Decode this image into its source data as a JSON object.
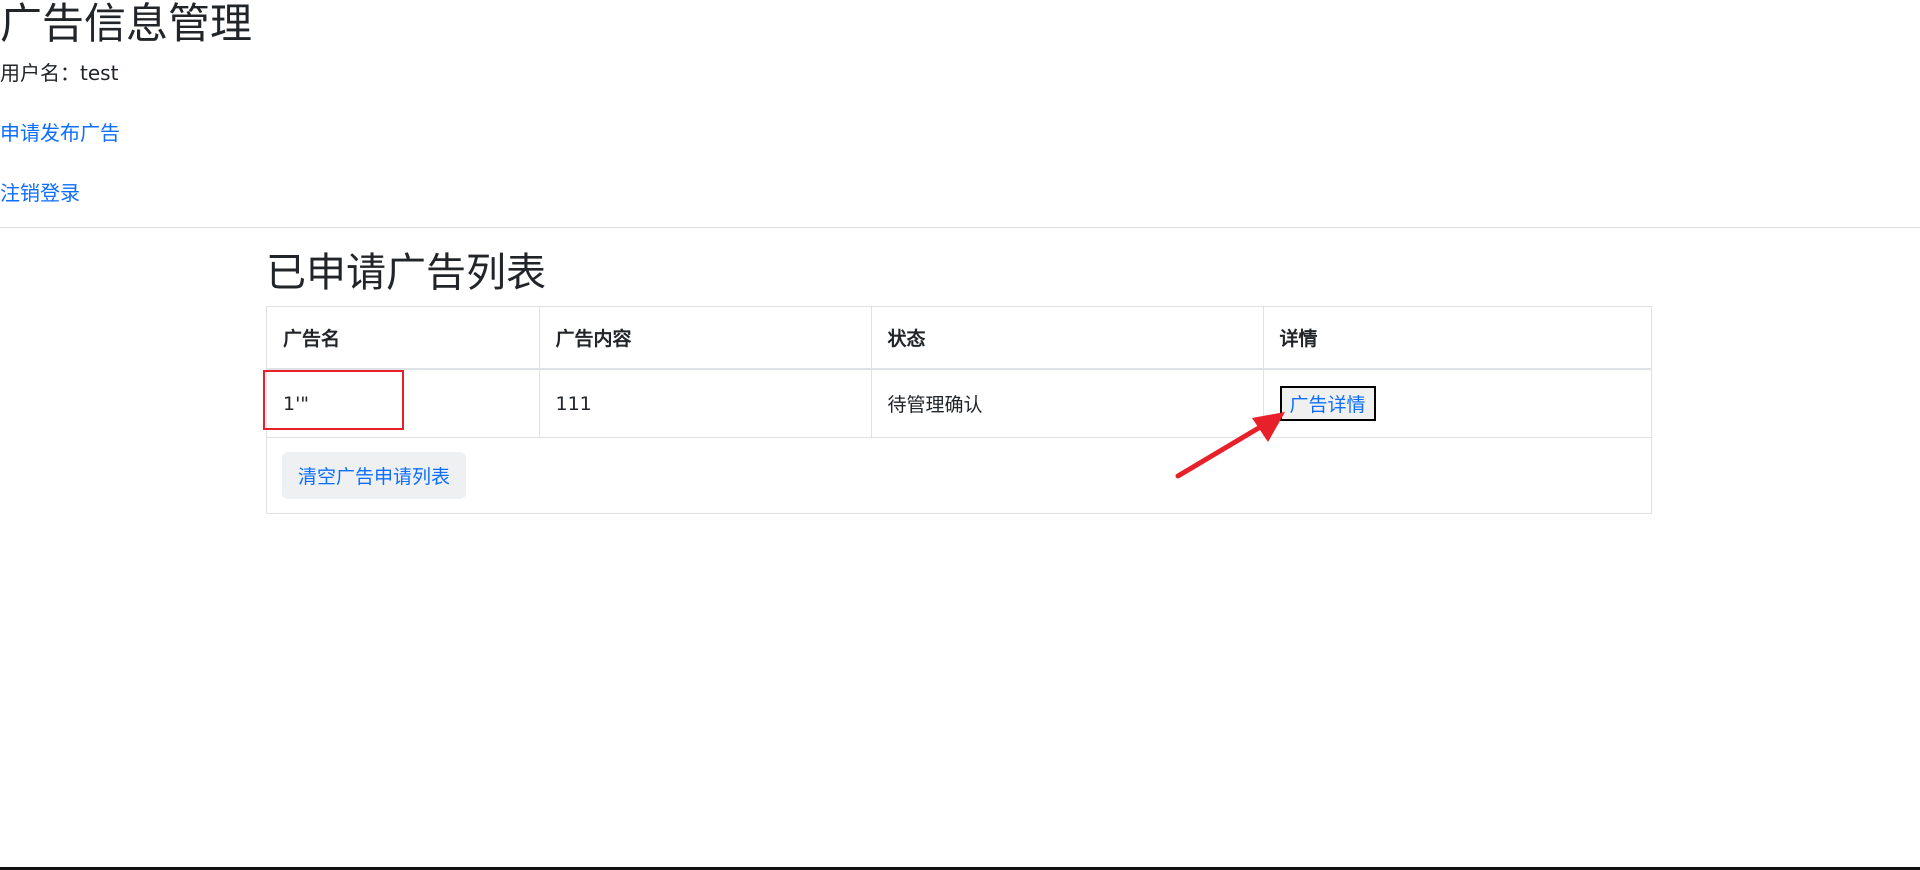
{
  "header": {
    "title": "广告信息管理",
    "username_line": "用户名：test"
  },
  "nav": {
    "apply_link": "申请发布广告",
    "logout_link": "注销登录"
  },
  "main": {
    "section_title": "已申请广告列表",
    "table": {
      "columns": [
        "广告名",
        "广告内容",
        "状态",
        "详情"
      ],
      "rows": [
        {
          "name": "1'\"",
          "content": "111",
          "status": "待管理确认",
          "detail_button": "广告详情"
        }
      ]
    },
    "clear_button": "清空广告申请列表"
  },
  "colors": {
    "link": "#0d6efd",
    "annotation": "#e8202a"
  }
}
